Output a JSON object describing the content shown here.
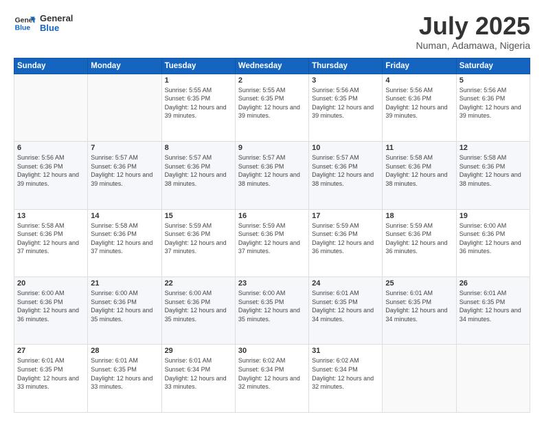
{
  "logo": {
    "line1": "General",
    "line2": "Blue"
  },
  "title": "July 2025",
  "subtitle": "Numan, Adamawa, Nigeria",
  "weekdays": [
    "Sunday",
    "Monday",
    "Tuesday",
    "Wednesday",
    "Thursday",
    "Friday",
    "Saturday"
  ],
  "weeks": [
    [
      {
        "day": "",
        "info": ""
      },
      {
        "day": "",
        "info": ""
      },
      {
        "day": "1",
        "info": "Sunrise: 5:55 AM\nSunset: 6:35 PM\nDaylight: 12 hours and 39 minutes."
      },
      {
        "day": "2",
        "info": "Sunrise: 5:55 AM\nSunset: 6:35 PM\nDaylight: 12 hours and 39 minutes."
      },
      {
        "day": "3",
        "info": "Sunrise: 5:56 AM\nSunset: 6:35 PM\nDaylight: 12 hours and 39 minutes."
      },
      {
        "day": "4",
        "info": "Sunrise: 5:56 AM\nSunset: 6:36 PM\nDaylight: 12 hours and 39 minutes."
      },
      {
        "day": "5",
        "info": "Sunrise: 5:56 AM\nSunset: 6:36 PM\nDaylight: 12 hours and 39 minutes."
      }
    ],
    [
      {
        "day": "6",
        "info": "Sunrise: 5:56 AM\nSunset: 6:36 PM\nDaylight: 12 hours and 39 minutes."
      },
      {
        "day": "7",
        "info": "Sunrise: 5:57 AM\nSunset: 6:36 PM\nDaylight: 12 hours and 39 minutes."
      },
      {
        "day": "8",
        "info": "Sunrise: 5:57 AM\nSunset: 6:36 PM\nDaylight: 12 hours and 38 minutes."
      },
      {
        "day": "9",
        "info": "Sunrise: 5:57 AM\nSunset: 6:36 PM\nDaylight: 12 hours and 38 minutes."
      },
      {
        "day": "10",
        "info": "Sunrise: 5:57 AM\nSunset: 6:36 PM\nDaylight: 12 hours and 38 minutes."
      },
      {
        "day": "11",
        "info": "Sunrise: 5:58 AM\nSunset: 6:36 PM\nDaylight: 12 hours and 38 minutes."
      },
      {
        "day": "12",
        "info": "Sunrise: 5:58 AM\nSunset: 6:36 PM\nDaylight: 12 hours and 38 minutes."
      }
    ],
    [
      {
        "day": "13",
        "info": "Sunrise: 5:58 AM\nSunset: 6:36 PM\nDaylight: 12 hours and 37 minutes."
      },
      {
        "day": "14",
        "info": "Sunrise: 5:58 AM\nSunset: 6:36 PM\nDaylight: 12 hours and 37 minutes."
      },
      {
        "day": "15",
        "info": "Sunrise: 5:59 AM\nSunset: 6:36 PM\nDaylight: 12 hours and 37 minutes."
      },
      {
        "day": "16",
        "info": "Sunrise: 5:59 AM\nSunset: 6:36 PM\nDaylight: 12 hours and 37 minutes."
      },
      {
        "day": "17",
        "info": "Sunrise: 5:59 AM\nSunset: 6:36 PM\nDaylight: 12 hours and 36 minutes."
      },
      {
        "day": "18",
        "info": "Sunrise: 5:59 AM\nSunset: 6:36 PM\nDaylight: 12 hours and 36 minutes."
      },
      {
        "day": "19",
        "info": "Sunrise: 6:00 AM\nSunset: 6:36 PM\nDaylight: 12 hours and 36 minutes."
      }
    ],
    [
      {
        "day": "20",
        "info": "Sunrise: 6:00 AM\nSunset: 6:36 PM\nDaylight: 12 hours and 36 minutes."
      },
      {
        "day": "21",
        "info": "Sunrise: 6:00 AM\nSunset: 6:36 PM\nDaylight: 12 hours and 35 minutes."
      },
      {
        "day": "22",
        "info": "Sunrise: 6:00 AM\nSunset: 6:36 PM\nDaylight: 12 hours and 35 minutes."
      },
      {
        "day": "23",
        "info": "Sunrise: 6:00 AM\nSunset: 6:35 PM\nDaylight: 12 hours and 35 minutes."
      },
      {
        "day": "24",
        "info": "Sunrise: 6:01 AM\nSunset: 6:35 PM\nDaylight: 12 hours and 34 minutes."
      },
      {
        "day": "25",
        "info": "Sunrise: 6:01 AM\nSunset: 6:35 PM\nDaylight: 12 hours and 34 minutes."
      },
      {
        "day": "26",
        "info": "Sunrise: 6:01 AM\nSunset: 6:35 PM\nDaylight: 12 hours and 34 minutes."
      }
    ],
    [
      {
        "day": "27",
        "info": "Sunrise: 6:01 AM\nSunset: 6:35 PM\nDaylight: 12 hours and 33 minutes."
      },
      {
        "day": "28",
        "info": "Sunrise: 6:01 AM\nSunset: 6:35 PM\nDaylight: 12 hours and 33 minutes."
      },
      {
        "day": "29",
        "info": "Sunrise: 6:01 AM\nSunset: 6:34 PM\nDaylight: 12 hours and 33 minutes."
      },
      {
        "day": "30",
        "info": "Sunrise: 6:02 AM\nSunset: 6:34 PM\nDaylight: 12 hours and 32 minutes."
      },
      {
        "day": "31",
        "info": "Sunrise: 6:02 AM\nSunset: 6:34 PM\nDaylight: 12 hours and 32 minutes."
      },
      {
        "day": "",
        "info": ""
      },
      {
        "day": "",
        "info": ""
      }
    ]
  ]
}
